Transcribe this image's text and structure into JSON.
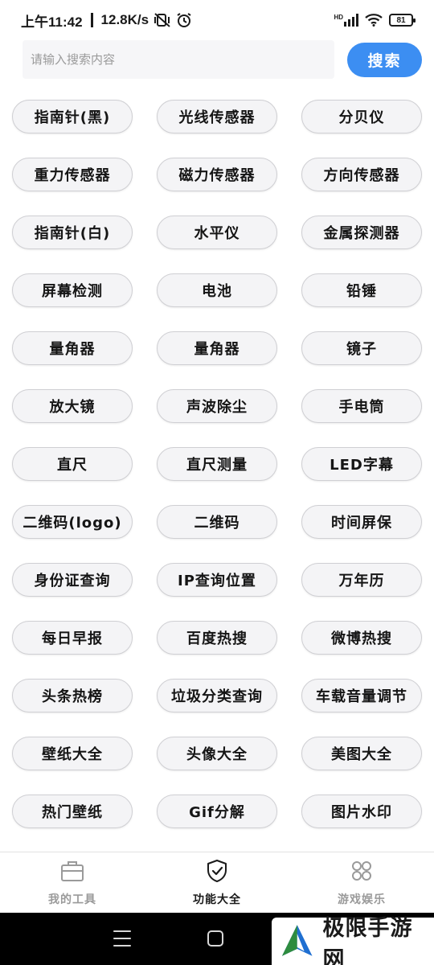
{
  "status_bar": {
    "time": "上午11:42",
    "net_speed": "12.8K/s",
    "signal_label": "HD",
    "battery": "81",
    "icons": [
      "mute-vibrate-icon",
      "alarm-icon",
      "signal-icon",
      "wifi-icon",
      "battery-icon"
    ]
  },
  "search": {
    "placeholder": "请输入搜索内容",
    "value": "",
    "button_label": "搜索",
    "accent_color": "#3c8ef2"
  },
  "tools": [
    "指南针(黑)",
    "光线传感器",
    "分贝仪",
    "重力传感器",
    "磁力传感器",
    "方向传感器",
    "指南针(白)",
    "水平仪",
    "金属探测器",
    "屏幕检测",
    "电池",
    "铅锤",
    "量角器",
    "量角器",
    "镜子",
    "放大镜",
    "声波除尘",
    "手电筒",
    "直尺",
    "直尺测量",
    "LED字幕",
    "二维码(logo)",
    "二维码",
    "时间屏保",
    "身份证查询",
    "IP查询位置",
    "万年历",
    "每日早报",
    "百度热搜",
    "微博热搜",
    "头条热榜",
    "垃圾分类查询",
    "车载音量调节",
    "壁纸大全",
    "头像大全",
    "美图大全",
    "热门壁纸",
    "Gif分解",
    "图片水印"
  ],
  "tab_bar": {
    "tabs": [
      {
        "label": "我的工具",
        "icon": "toolbox-icon",
        "active": false
      },
      {
        "label": "功能大全",
        "icon": "shield-check-icon",
        "active": true
      },
      {
        "label": "游戏娱乐",
        "icon": "clover-icon",
        "active": false
      }
    ]
  },
  "nav_bar": {
    "icons": [
      "menu-icon",
      "home-icon"
    ]
  },
  "watermark": {
    "text": "极限手游网",
    "logo": "arrow-logo"
  }
}
